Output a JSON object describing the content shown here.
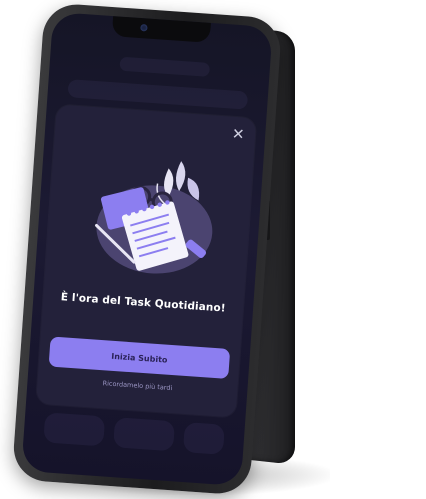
{
  "modal": {
    "close_label": "✕",
    "title": "È l'ora del Task Quotidiano!",
    "primary_button": "Inizia Subito",
    "secondary_link": "Ricordamelo più tardi"
  },
  "colors": {
    "accent": "#8c7ef0",
    "modal_bg": "#23213a",
    "screen_bg": "#1c1a33"
  },
  "icons": [
    "close-icon",
    "notepad-illustration",
    "glasses-icon",
    "pencil-icon",
    "leaf-icon"
  ]
}
